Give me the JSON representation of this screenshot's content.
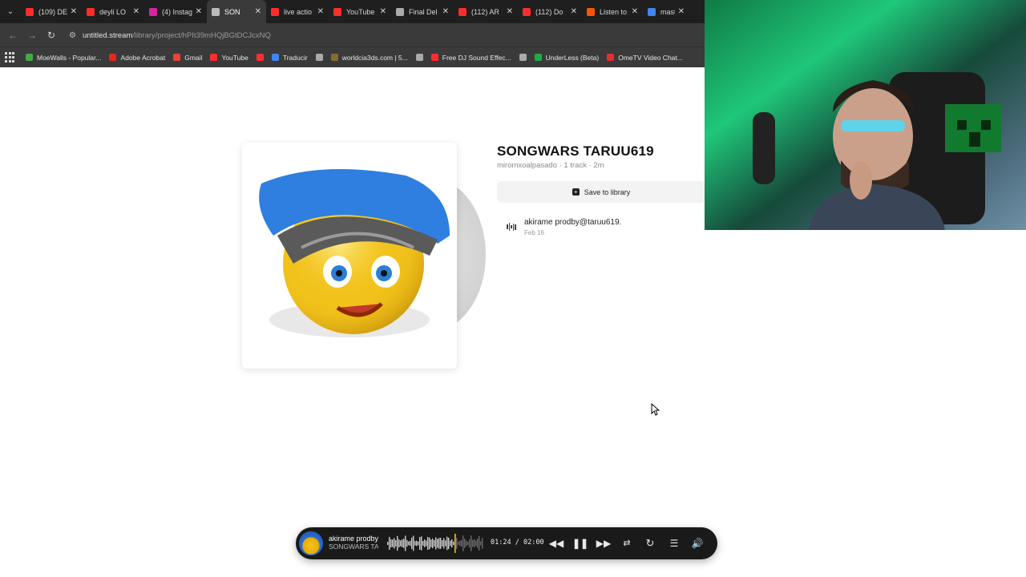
{
  "browser": {
    "tabs": [
      {
        "label": "(109) DE",
        "color": "#ff2d2d",
        "active": false
      },
      {
        "label": "deyli LO",
        "color": "#ff2d2d",
        "active": false
      },
      {
        "label": "(4) Instag",
        "color": "#d6249f",
        "active": false
      },
      {
        "label": "SON",
        "color": "#bbbbbb",
        "active": true
      },
      {
        "label": "live actio",
        "color": "#ff2d2d",
        "active": false
      },
      {
        "label": "YouTube",
        "color": "#ff2d2d",
        "active": false
      },
      {
        "label": "Final Del",
        "color": "#aaaaaa",
        "active": false
      },
      {
        "label": "(112) AR",
        "color": "#ff2d2d",
        "active": false
      },
      {
        "label": "(112) Do",
        "color": "#ff2d2d",
        "active": false
      },
      {
        "label": "Listen to",
        "color": "#ff5500",
        "active": false
      },
      {
        "label": "master f",
        "color": "#4285f4",
        "active": false
      }
    ],
    "url_host": "untitled.stream",
    "url_path": "/library/project/hPIt39mHQjBGtDCJcxNQ",
    "bookmarks": [
      {
        "label": "MoeWalls - Popular...",
        "color": "#44aa44"
      },
      {
        "label": "Adobe Acrobat",
        "color": "#e0281d"
      },
      {
        "label": "Gmail",
        "color": "#ea4335"
      },
      {
        "label": "YouTube",
        "color": "#ff2d2d"
      },
      {
        "label": "",
        "color": "#ff2d2d"
      },
      {
        "label": "Traducir",
        "color": "#4285f4"
      },
      {
        "label": "",
        "color": "#aaaaaa"
      },
      {
        "label": "worldcia3ds.com | 5...",
        "color": "#8b6b2b"
      },
      {
        "label": "",
        "color": "#aaaaaa"
      },
      {
        "label": "Free DJ Sound Effec...",
        "color": "#ff2d2d"
      },
      {
        "label": "",
        "color": "#aaaaaa"
      },
      {
        "label": "UnderLess (Beta)",
        "color": "#22aa44"
      },
      {
        "label": "OmeTV Video Chat...",
        "color": "#e03030"
      }
    ]
  },
  "project": {
    "title": "SONGWARS TARUU619",
    "meta": "miromxoalpasado · 1 track · 2m",
    "save_label": "Save to library",
    "tracks": [
      {
        "name": "akirame prodby@taruu619.",
        "date": "Feb 16"
      }
    ]
  },
  "player": {
    "track_title": "akirame prodby",
    "project_title": "SONGWARS TA",
    "current_time": "01:24",
    "separator": "/",
    "duration": "02:00",
    "progress": 0.7
  },
  "icons": {
    "prev": "rewind-icon",
    "pause": "pause-icon",
    "next": "fast-forward-icon",
    "shuffle": "shuffle-icon",
    "repeat": "repeat-icon",
    "queue": "queue-icon",
    "volume": "volume-icon"
  }
}
